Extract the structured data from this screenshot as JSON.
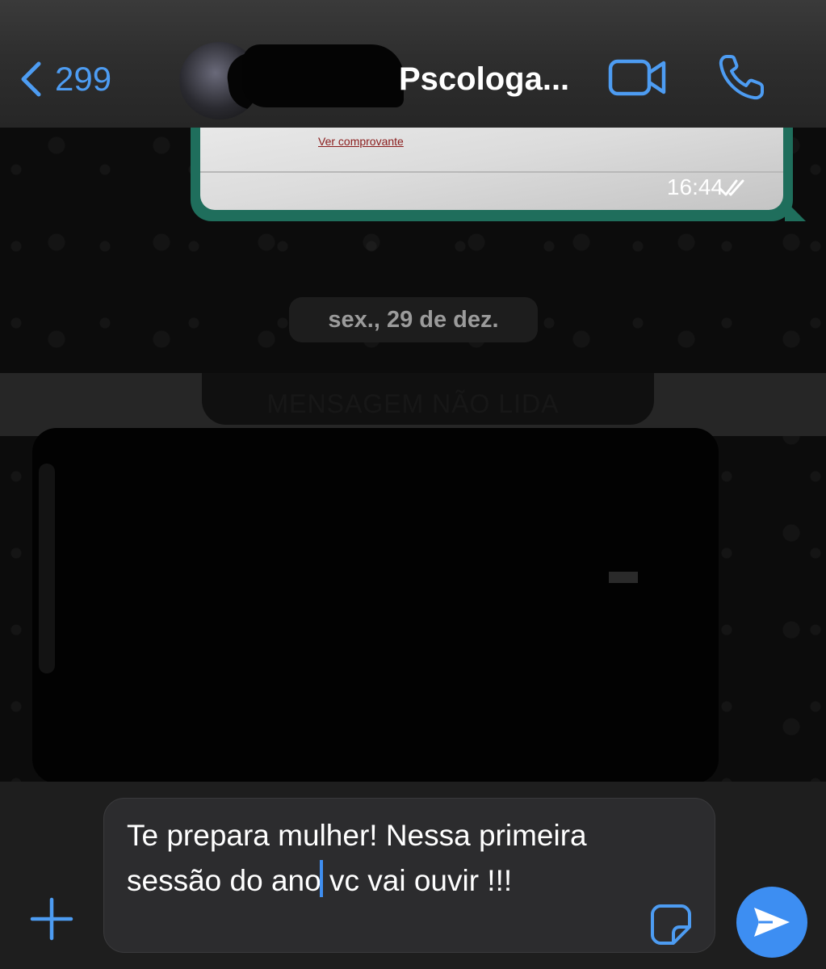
{
  "colors": {
    "accent": "#4d9cf2",
    "outgoing_bubble": "#1f6e5c",
    "background": "#0b0b0b",
    "send_button": "#3d8ef2"
  },
  "header": {
    "back_count": "299",
    "contact_name": "Pscologa...",
    "icons": [
      "chevron-left-icon",
      "video-camera-icon",
      "phone-icon"
    ]
  },
  "messages": {
    "outgoing_image": {
      "link_text": "Ver comprovante",
      "time": "16:44",
      "status_icon": "double-check-icon"
    },
    "date_separator": "sex., 29 de dez.",
    "unread_banner": "MENSAGEM NÃO LIDA"
  },
  "composer": {
    "text_before_cursor": "Te prepara mulher! Nessa primeira sessão do ano",
    "text_after_cursor": " vc vai ouvir !!!",
    "icons": [
      "plus-icon",
      "sticker-icon",
      "send-icon"
    ]
  }
}
